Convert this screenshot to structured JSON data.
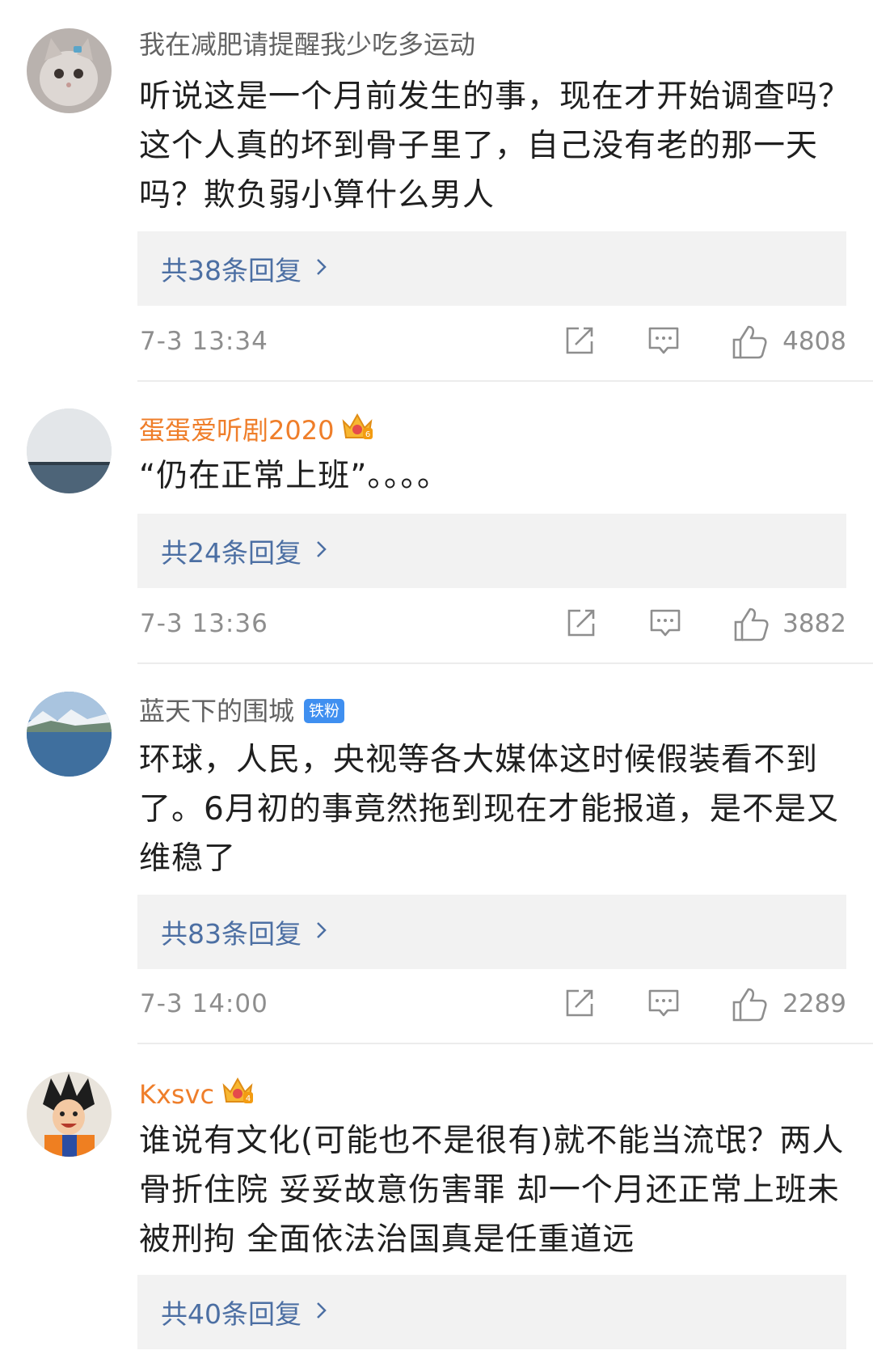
{
  "comments": [
    {
      "username": "我在减肥请提醒我少吃多运动",
      "text": "听说这是一个月前发生的事，现在才开始调查吗？这个人真的坏到骨子里了，自己没有老的那一天吗？欺负弱小算什么男人",
      "replies": "共38条回复",
      "time": "7-3 13:34",
      "likes": "4808"
    },
    {
      "username": "蛋蛋爱听剧2020",
      "text": "“仍在正常上班”。。。。",
      "replies": "共24条回复",
      "time": "7-3 13:36",
      "likes": "3882"
    },
    {
      "username": "蓝天下的围城",
      "badge": "铁粉",
      "text": "环球，人民，央视等各大媒体这时候假装看不到了。6月初的事竟然拖到现在才能报道，是不是又维稳了",
      "replies": "共83条回复",
      "time": "7-3 14:00",
      "likes": "2289"
    },
    {
      "username": "Kxsvc",
      "text": "谁说有文化(可能也不是很有)就不能当流氓？两人骨折住院 妥妥故意伤害罪 却一个月还正常上班未被刑拘 全面依法治国真是任重道远",
      "replies": "共40条回复"
    }
  ],
  "icons": {
    "share": "share-icon",
    "comment": "comment-icon",
    "like": "thumbs-up-icon",
    "chevron": "chevron-right-icon",
    "crown": "crown-badge-icon"
  },
  "colors": {
    "username": "#636363",
    "vip_username": "#ef7e2a",
    "reply_link": "#4c6fa3",
    "meta": "#8e8e8e",
    "reply_bg": "#f2f2f2",
    "fan_badge": "#3f8ff0"
  }
}
